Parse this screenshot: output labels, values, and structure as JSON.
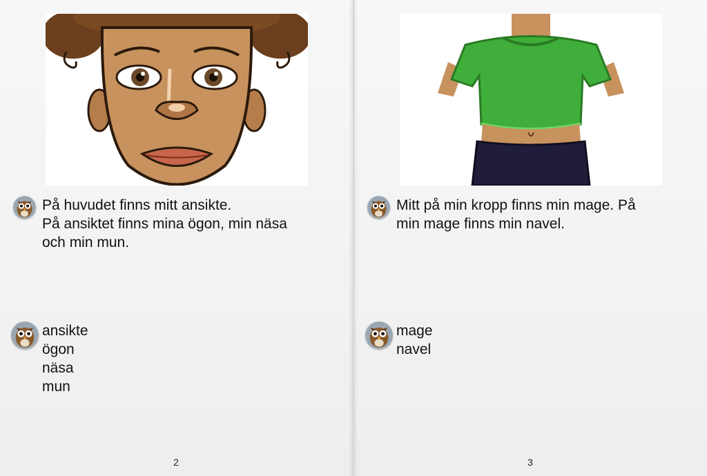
{
  "left_page": {
    "paragraph_lines": [
      "På huvudet finns mitt ansikte.",
      "På ansiktet finns mina ögon, min näsa",
      "och min mun."
    ],
    "word_list": [
      "ansikte",
      "ögon",
      "näsa",
      "mun"
    ],
    "page_number": "2",
    "illustration_icon": "face-illustration",
    "audio_icon": "owl-icon"
  },
  "right_page": {
    "paragraph_lines": [
      "Mitt på min kropp finns min mage. På",
      "min mage finns min navel."
    ],
    "word_list": [
      "mage",
      "navel"
    ],
    "page_number": "3",
    "illustration_icon": "torso-illustration",
    "audio_icon": "owl-icon"
  },
  "colors": {
    "skin": "#c8925e",
    "hair": "#6b3f1d",
    "shirt": "#3fae3a",
    "pants": "#1f1d3a",
    "owl": "#8a5a2b"
  }
}
